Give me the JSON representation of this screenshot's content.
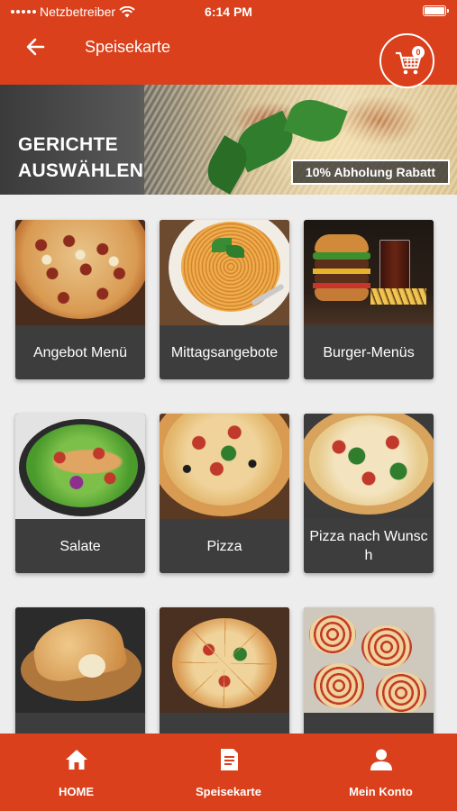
{
  "status_bar": {
    "carrier": "Netzbetreiber",
    "time": "6:14 PM"
  },
  "header": {
    "title": "Speisekarte",
    "cart_count": "0"
  },
  "hero": {
    "title_line1": "GERICHTE",
    "title_line2": "AUSWÄHLEN",
    "promo": "10% Abholung Rabatt"
  },
  "categories": [
    {
      "label": "Angebot Menü"
    },
    {
      "label": "Mittagsangebote"
    },
    {
      "label": "Burger-Menüs"
    },
    {
      "label": "Salate"
    },
    {
      "label": "Pizza"
    },
    {
      "label": "Pizza nach Wunsch"
    }
  ],
  "bottom_nav": [
    {
      "label": "HOME",
      "icon": "home-icon"
    },
    {
      "label": "Speisekarte",
      "icon": "menu-document-icon"
    },
    {
      "label": "Mein Konto",
      "icon": "user-icon"
    }
  ],
  "colors": {
    "brand": "#d9401b",
    "card": "#3d3d3d",
    "background": "#ededed"
  }
}
